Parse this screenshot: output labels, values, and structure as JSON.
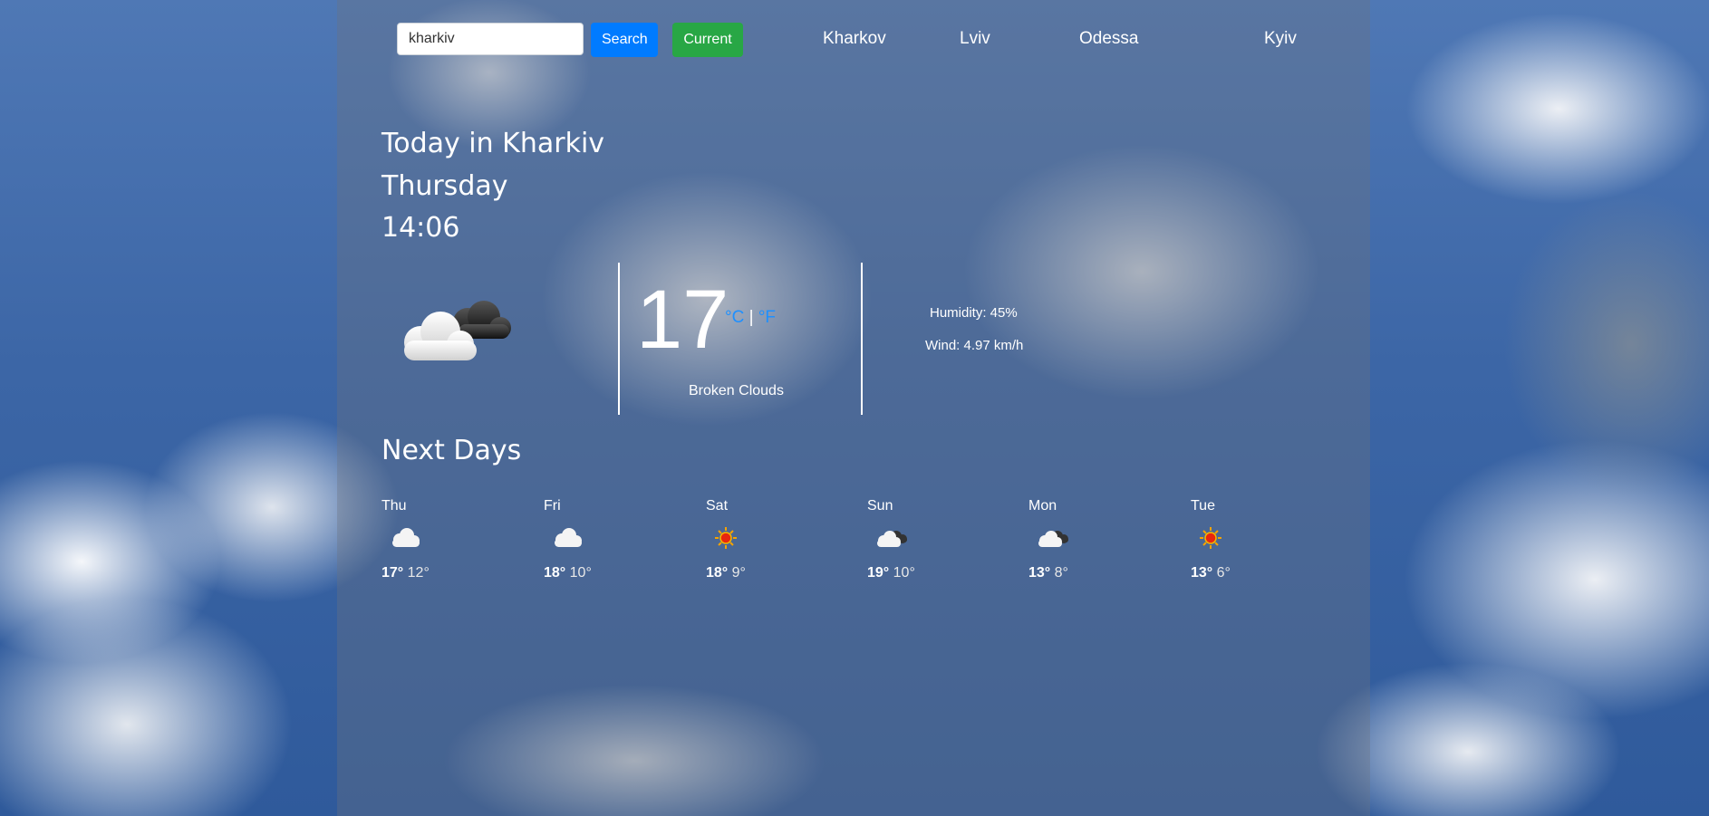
{
  "colors": {
    "accent": "#1e90ff",
    "search_button": "#007bff",
    "current_button": "#28a745"
  },
  "search": {
    "value": "kharkiv",
    "button_label": "Search",
    "current_label": "Current"
  },
  "cities": [
    "Kharkov",
    "Lviv",
    "Odessa",
    "Kyiv"
  ],
  "today": {
    "title": "Today in Kharkiv",
    "weekday": "Thursday",
    "time": "14:06"
  },
  "current": {
    "icon": "broken-clouds-icon",
    "temperature": "17",
    "unit_c": "°C",
    "unit_sep": "|",
    "unit_f": "°F",
    "description": "Broken Clouds",
    "humidity": "Humidity: 45%",
    "wind": "Wind: 4.97 km/h"
  },
  "forecast_title": "Next Days",
  "forecast": [
    {
      "day": "Thu",
      "icon": "cloud-icon",
      "max": "17°",
      "min": "12°"
    },
    {
      "day": "Fri",
      "icon": "cloud-icon",
      "max": "18°",
      "min": "10°"
    },
    {
      "day": "Sat",
      "icon": "sun-icon",
      "max": "18°",
      "min": "9°"
    },
    {
      "day": "Sun",
      "icon": "broken-clouds-icon",
      "max": "19°",
      "min": "10°"
    },
    {
      "day": "Mon",
      "icon": "broken-clouds-icon",
      "max": "13°",
      "min": "8°"
    },
    {
      "day": "Tue",
      "icon": "sun-icon",
      "max": "13°",
      "min": "6°"
    }
  ]
}
